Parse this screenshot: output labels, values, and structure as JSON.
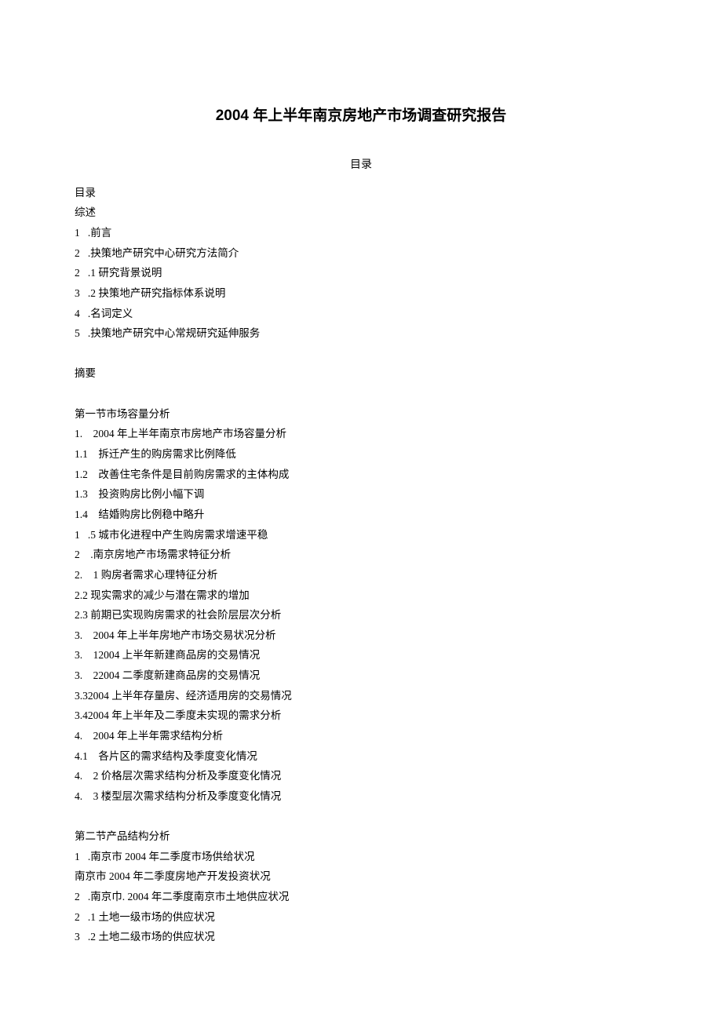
{
  "title": "2004 年上半年南京房地产市场调查研究报告",
  "subtitle": "目录",
  "lines": [
    "目录",
    "综述",
    "1   .前言",
    "2   .抉策地产研究中心研究方法简介",
    "2   .1 研究背景说明",
    "3   .2 抉策地产研究指标体系说明",
    "4   .名词定义",
    "5   .抉策地产研究中心常规研究延伸服务",
    "",
    "摘要",
    "",
    "第一节市场容量分析",
    "1.    2004 年上半年南京市房地产市场容量分析",
    "1.1    拆迁产生的购房需求比例降低",
    "1.2    改善住宅条件是目前购房需求的主体构成",
    "1.3    投资购房比例小幅下调",
    "1.4    结婚购房比例稳中略升",
    "1   .5 城市化进程中产生购房需求增速平稳",
    "2    .南京房地产市场需求特征分析",
    "2.    1 购房者需求心理特征分析",
    "2.2 现实需求的减少与潜在需求的增加",
    "2.3 前期已实现购房需求的社会阶层层次分析",
    "3.    2004 年上半年房地产市场交易状况分析",
    "3.    12004 上半年新建商品房的交易情况",
    "3.    22004 二季度新建商品房的交易情况",
    "3.32004 上半年存量房、经济适用房的交易情况",
    "3.42004 年上半年及二季度未实现的需求分析",
    "4.    2004 年上半年需求结构分析",
    "4.1    各片区的需求结构及季度变化情况",
    "4.    2 价格层次需求结构分析及季度变化情况",
    "4.    3 楼型层次需求结构分析及季度变化情况",
    "",
    "第二节产品结构分析",
    "1   .南京市 2004 年二季度市场供给状况",
    "南京市 2004 年二季度房地产开发投资状况",
    "2   .南京巾. 2004 年二季度南京市土地供应状况",
    "2   .1 土地一级市场的供应状况",
    "3   .2 土地二级市场的供应状况"
  ]
}
